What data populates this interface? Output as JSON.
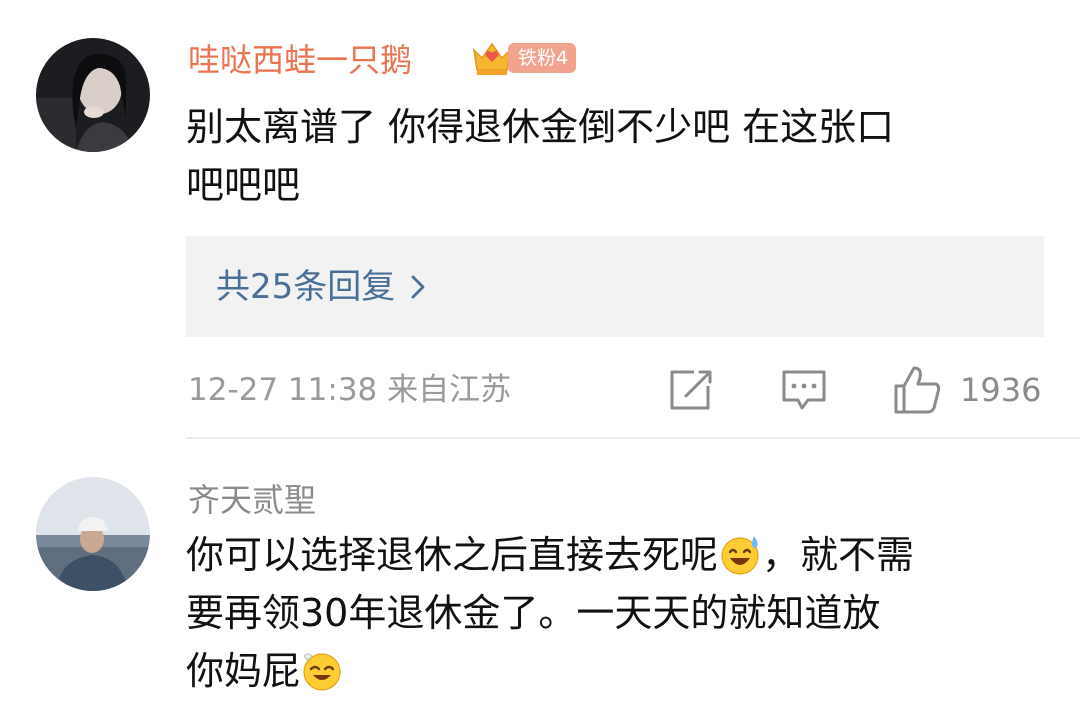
{
  "comments": [
    {
      "username": "哇哒西蛙一只鹅",
      "fan_badge": "铁粉4",
      "text_lines": [
        "别太离谱了 你得退休金倒不少吧 在这张口",
        "吧吧吧"
      ],
      "replies_link": "共25条回复",
      "meta": "12-27 11:38 来自江苏",
      "likes": "1936"
    },
    {
      "username": "齐天贰聖",
      "text_line1": "你可以选择退休之后直接去死呢",
      "text_line1_tail": "，就不需",
      "text_line2": "要再领30年退休金了。一天天的就知道放",
      "text_line3": "你妈屁"
    }
  ],
  "icons": {
    "share": "edit-share-icon",
    "comment": "comment-bubble-icon",
    "like": "thumbs-up-icon",
    "chevron": "chevron-right-icon",
    "badge": "crown-heart-icon"
  },
  "colors": {
    "username_vip": "#eb7350",
    "username_normal": "#8b8b8b",
    "link": "#4a6f96",
    "meta": "#9a9a9a",
    "badge_bg": "#f1a38e"
  }
}
